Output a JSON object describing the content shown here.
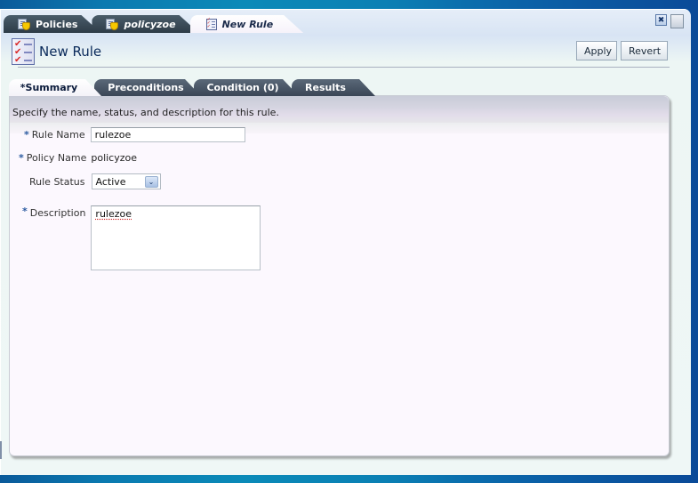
{
  "doc_tabs": [
    {
      "label": "Policies",
      "icon": "policy-icon",
      "active": false
    },
    {
      "label": "policyzoe",
      "icon": "policy-icon",
      "active": false
    },
    {
      "label": "New Rule",
      "icon": "rule-icon",
      "active": true
    }
  ],
  "window_controls": {
    "close_icon": "close-icon",
    "restore_icon": "restore-icon",
    "close_glyph": "✖"
  },
  "header": {
    "title": "New Rule",
    "icon": "rule-checklist-icon",
    "apply_label": "Apply",
    "revert_label": "Revert"
  },
  "sub_tabs": [
    {
      "label": "*Summary",
      "active": true
    },
    {
      "label": "Preconditions",
      "active": false
    },
    {
      "label": "Condition (0)",
      "active": false
    },
    {
      "label": "Results",
      "active": false
    }
  ],
  "summary": {
    "instructions": "Specify the name, status, and description for this rule.",
    "required_marker": "*",
    "rule_name": {
      "label": "Rule Name",
      "value": "rulezoe"
    },
    "policy_name": {
      "label": "Policy Name",
      "value": "policyzoe"
    },
    "rule_status": {
      "label": "Rule Status",
      "selected": "Active",
      "arrow": "⌄"
    },
    "description": {
      "label": "Description",
      "value": "rulezoe"
    }
  }
}
